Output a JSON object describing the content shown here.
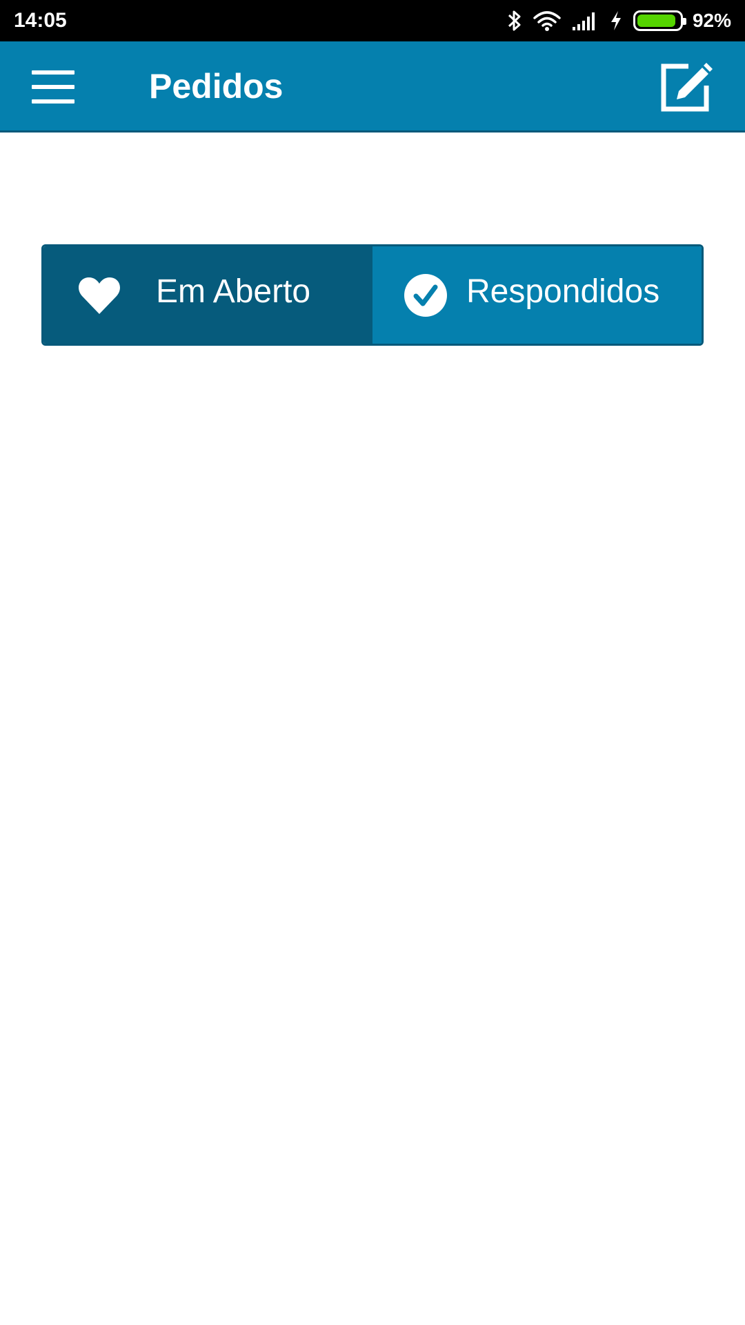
{
  "status_bar": {
    "time": "14:05",
    "battery_percent": "92%",
    "battery_level": 0.92,
    "icons": [
      "bluetooth-icon",
      "wifi-icon",
      "signal-icon",
      "charging-icon",
      "battery-icon"
    ]
  },
  "app_bar": {
    "title": "Pedidos",
    "menu_icon": "hamburger-menu-icon",
    "action_icon": "compose-edit-icon"
  },
  "segments": [
    {
      "label": "Em Aberto",
      "icon": "heart-icon",
      "selected": true
    },
    {
      "label": "Respondidos",
      "icon": "check-circle-icon",
      "selected": false
    }
  ],
  "colors": {
    "primary": "#0580ae",
    "primary_dark": "#065b7c",
    "battery": "#55d400",
    "background": "#ffffff"
  }
}
